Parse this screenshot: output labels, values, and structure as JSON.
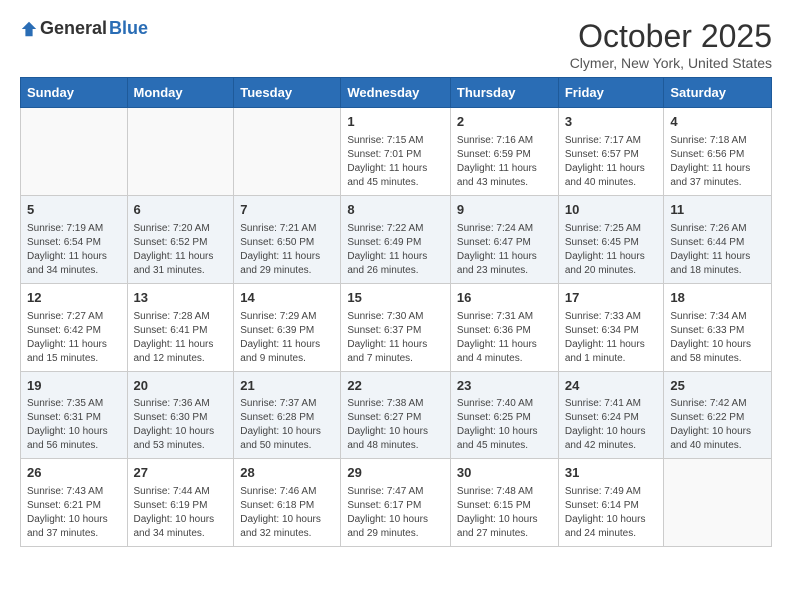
{
  "header": {
    "logo_general": "General",
    "logo_blue": "Blue",
    "month_title": "October 2025",
    "location": "Clymer, New York, United States"
  },
  "days_of_week": [
    "Sunday",
    "Monday",
    "Tuesday",
    "Wednesday",
    "Thursday",
    "Friday",
    "Saturday"
  ],
  "weeks": [
    [
      {
        "day": "",
        "info": ""
      },
      {
        "day": "",
        "info": ""
      },
      {
        "day": "",
        "info": ""
      },
      {
        "day": "1",
        "info": "Sunrise: 7:15 AM\nSunset: 7:01 PM\nDaylight: 11 hours and 45 minutes."
      },
      {
        "day": "2",
        "info": "Sunrise: 7:16 AM\nSunset: 6:59 PM\nDaylight: 11 hours and 43 minutes."
      },
      {
        "day": "3",
        "info": "Sunrise: 7:17 AM\nSunset: 6:57 PM\nDaylight: 11 hours and 40 minutes."
      },
      {
        "day": "4",
        "info": "Sunrise: 7:18 AM\nSunset: 6:56 PM\nDaylight: 11 hours and 37 minutes."
      }
    ],
    [
      {
        "day": "5",
        "info": "Sunrise: 7:19 AM\nSunset: 6:54 PM\nDaylight: 11 hours and 34 minutes."
      },
      {
        "day": "6",
        "info": "Sunrise: 7:20 AM\nSunset: 6:52 PM\nDaylight: 11 hours and 31 minutes."
      },
      {
        "day": "7",
        "info": "Sunrise: 7:21 AM\nSunset: 6:50 PM\nDaylight: 11 hours and 29 minutes."
      },
      {
        "day": "8",
        "info": "Sunrise: 7:22 AM\nSunset: 6:49 PM\nDaylight: 11 hours and 26 minutes."
      },
      {
        "day": "9",
        "info": "Sunrise: 7:24 AM\nSunset: 6:47 PM\nDaylight: 11 hours and 23 minutes."
      },
      {
        "day": "10",
        "info": "Sunrise: 7:25 AM\nSunset: 6:45 PM\nDaylight: 11 hours and 20 minutes."
      },
      {
        "day": "11",
        "info": "Sunrise: 7:26 AM\nSunset: 6:44 PM\nDaylight: 11 hours and 18 minutes."
      }
    ],
    [
      {
        "day": "12",
        "info": "Sunrise: 7:27 AM\nSunset: 6:42 PM\nDaylight: 11 hours and 15 minutes."
      },
      {
        "day": "13",
        "info": "Sunrise: 7:28 AM\nSunset: 6:41 PM\nDaylight: 11 hours and 12 minutes."
      },
      {
        "day": "14",
        "info": "Sunrise: 7:29 AM\nSunset: 6:39 PM\nDaylight: 11 hours and 9 minutes."
      },
      {
        "day": "15",
        "info": "Sunrise: 7:30 AM\nSunset: 6:37 PM\nDaylight: 11 hours and 7 minutes."
      },
      {
        "day": "16",
        "info": "Sunrise: 7:31 AM\nSunset: 6:36 PM\nDaylight: 11 hours and 4 minutes."
      },
      {
        "day": "17",
        "info": "Sunrise: 7:33 AM\nSunset: 6:34 PM\nDaylight: 11 hours and 1 minute."
      },
      {
        "day": "18",
        "info": "Sunrise: 7:34 AM\nSunset: 6:33 PM\nDaylight: 10 hours and 58 minutes."
      }
    ],
    [
      {
        "day": "19",
        "info": "Sunrise: 7:35 AM\nSunset: 6:31 PM\nDaylight: 10 hours and 56 minutes."
      },
      {
        "day": "20",
        "info": "Sunrise: 7:36 AM\nSunset: 6:30 PM\nDaylight: 10 hours and 53 minutes."
      },
      {
        "day": "21",
        "info": "Sunrise: 7:37 AM\nSunset: 6:28 PM\nDaylight: 10 hours and 50 minutes."
      },
      {
        "day": "22",
        "info": "Sunrise: 7:38 AM\nSunset: 6:27 PM\nDaylight: 10 hours and 48 minutes."
      },
      {
        "day": "23",
        "info": "Sunrise: 7:40 AM\nSunset: 6:25 PM\nDaylight: 10 hours and 45 minutes."
      },
      {
        "day": "24",
        "info": "Sunrise: 7:41 AM\nSunset: 6:24 PM\nDaylight: 10 hours and 42 minutes."
      },
      {
        "day": "25",
        "info": "Sunrise: 7:42 AM\nSunset: 6:22 PM\nDaylight: 10 hours and 40 minutes."
      }
    ],
    [
      {
        "day": "26",
        "info": "Sunrise: 7:43 AM\nSunset: 6:21 PM\nDaylight: 10 hours and 37 minutes."
      },
      {
        "day": "27",
        "info": "Sunrise: 7:44 AM\nSunset: 6:19 PM\nDaylight: 10 hours and 34 minutes."
      },
      {
        "day": "28",
        "info": "Sunrise: 7:46 AM\nSunset: 6:18 PM\nDaylight: 10 hours and 32 minutes."
      },
      {
        "day": "29",
        "info": "Sunrise: 7:47 AM\nSunset: 6:17 PM\nDaylight: 10 hours and 29 minutes."
      },
      {
        "day": "30",
        "info": "Sunrise: 7:48 AM\nSunset: 6:15 PM\nDaylight: 10 hours and 27 minutes."
      },
      {
        "day": "31",
        "info": "Sunrise: 7:49 AM\nSunset: 6:14 PM\nDaylight: 10 hours and 24 minutes."
      },
      {
        "day": "",
        "info": ""
      }
    ]
  ]
}
